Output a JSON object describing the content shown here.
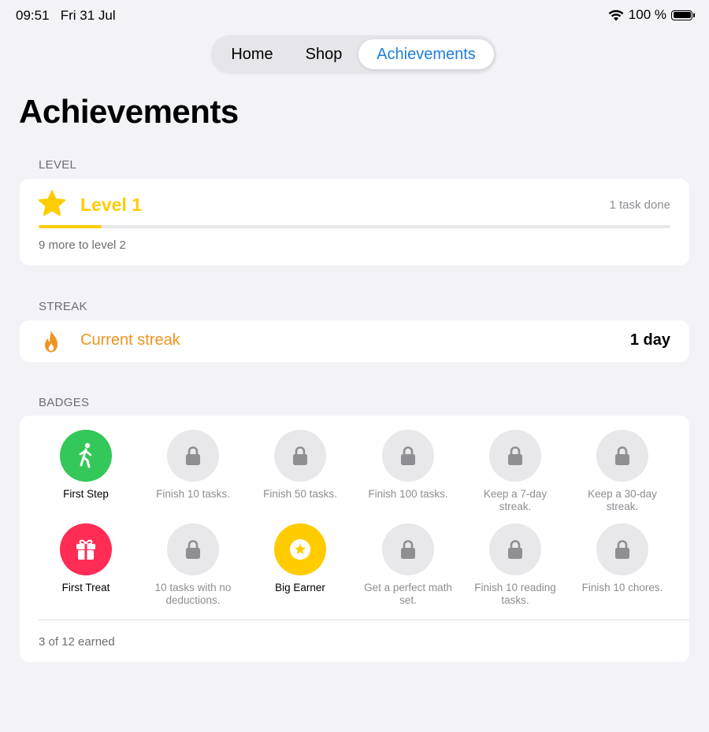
{
  "status": {
    "time": "09:51",
    "date": "Fri 31 Jul",
    "battery": "100 %"
  },
  "tabs": [
    {
      "label": "Home",
      "selected": false
    },
    {
      "label": "Shop",
      "selected": false
    },
    {
      "label": "Achievements",
      "selected": true
    }
  ],
  "page_title": "Achievements",
  "level": {
    "header": "LEVEL",
    "title": "Level 1",
    "tasks_done": "1 task done",
    "progress_fraction": 0.1,
    "remaining": "9 more to level 2"
  },
  "streak": {
    "header": "STREAK",
    "label": "Current streak",
    "value": "1 day"
  },
  "badges": {
    "header": "BADGES",
    "items": [
      {
        "label": "First Step",
        "earned": true,
        "icon": "walking-person-icon",
        "color": "#34c759"
      },
      {
        "label": "Finish 10 tasks.",
        "earned": false,
        "icon": "lock-icon"
      },
      {
        "label": "Finish 50 tasks.",
        "earned": false,
        "icon": "lock-icon"
      },
      {
        "label": "Finish 100 tasks.",
        "earned": false,
        "icon": "lock-icon"
      },
      {
        "label": "Keep a 7-day streak.",
        "earned": false,
        "icon": "lock-icon"
      },
      {
        "label": "Keep a 30-day streak.",
        "earned": false,
        "icon": "lock-icon"
      },
      {
        "label": "First Treat",
        "earned": true,
        "icon": "gift-icon",
        "color": "#ff2d55"
      },
      {
        "label": "10 tasks with no deductions.",
        "earned": false,
        "icon": "lock-icon"
      },
      {
        "label": "Big Earner",
        "earned": true,
        "icon": "star-coin-icon",
        "color": "#ffcc00"
      },
      {
        "label": "Get a perfect math set.",
        "earned": false,
        "icon": "lock-icon"
      },
      {
        "label": "Finish 10 reading tasks.",
        "earned": false,
        "icon": "lock-icon"
      },
      {
        "label": "Finish 10 chores.",
        "earned": false,
        "icon": "lock-icon"
      }
    ],
    "footer": "3 of 12 earned"
  },
  "colors": {
    "accent": "#1c7ed6",
    "level": "#ffcc00",
    "streak": "#f0931e",
    "locked_bg": "#e8e8eb"
  }
}
